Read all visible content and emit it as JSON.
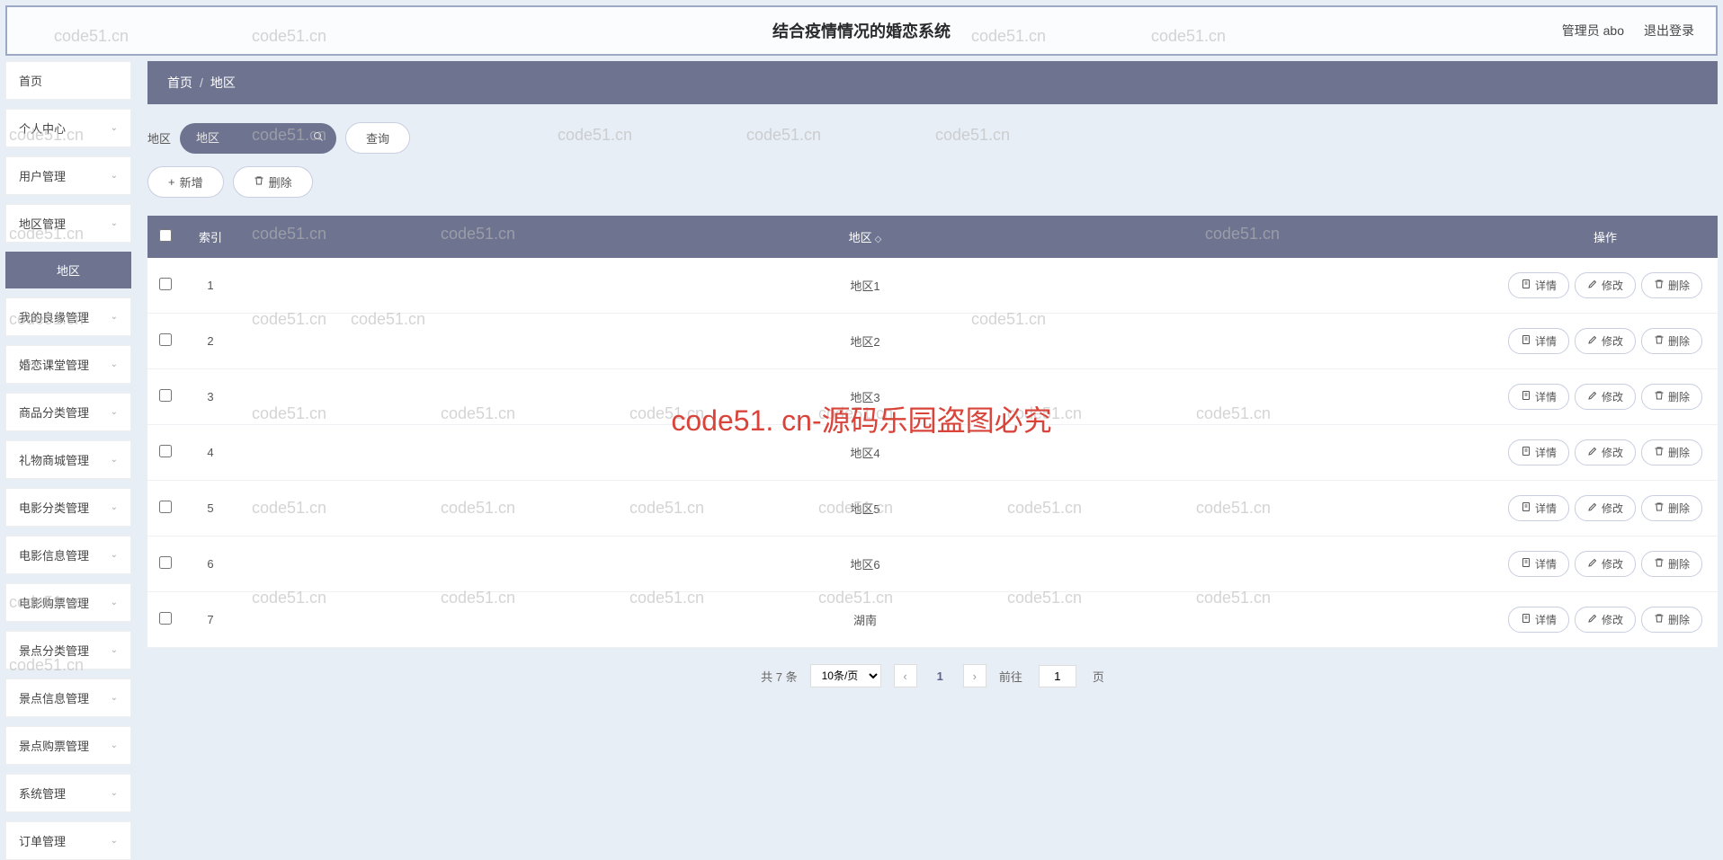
{
  "header": {
    "title": "结合疫情情况的婚恋系统",
    "admin_label": "管理员 abo",
    "logout_label": "退出登录"
  },
  "sidebar": {
    "items": [
      {
        "label": "首页",
        "expandable": false
      },
      {
        "label": "个人中心",
        "expandable": true
      },
      {
        "label": "用户管理",
        "expandable": true
      },
      {
        "label": "地区管理",
        "expandable": true
      },
      {
        "label": "地区",
        "expandable": false,
        "active": true
      },
      {
        "label": "我的良缘管理",
        "expandable": true
      },
      {
        "label": "婚恋课堂管理",
        "expandable": true
      },
      {
        "label": "商品分类管理",
        "expandable": true
      },
      {
        "label": "礼物商城管理",
        "expandable": true
      },
      {
        "label": "电影分类管理",
        "expandable": true
      },
      {
        "label": "电影信息管理",
        "expandable": true
      },
      {
        "label": "电影购票管理",
        "expandable": true
      },
      {
        "label": "景点分类管理",
        "expandable": true
      },
      {
        "label": "景点信息管理",
        "expandable": true
      },
      {
        "label": "景点购票管理",
        "expandable": true
      },
      {
        "label": "系统管理",
        "expandable": true
      },
      {
        "label": "订单管理",
        "expandable": true
      }
    ]
  },
  "breadcrumb": {
    "home": "首页",
    "current": "地区"
  },
  "filter": {
    "label": "地区",
    "search_placeholder": "地区",
    "query_button": "查询"
  },
  "toolbar": {
    "add_label": "新增",
    "delete_label": "删除"
  },
  "table": {
    "headers": {
      "index": "索引",
      "region": "地区",
      "actions": "操作"
    },
    "action_labels": {
      "detail": "详情",
      "edit": "修改",
      "delete": "删除"
    },
    "rows": [
      {
        "idx": "1",
        "region": "地区1"
      },
      {
        "idx": "2",
        "region": "地区2"
      },
      {
        "idx": "3",
        "region": "地区3"
      },
      {
        "idx": "4",
        "region": "地区4"
      },
      {
        "idx": "5",
        "region": "地区5"
      },
      {
        "idx": "6",
        "region": "地区6"
      },
      {
        "idx": "7",
        "region": "湖南"
      }
    ]
  },
  "pagination": {
    "total_label": "共 7 条",
    "page_size": "10条/页",
    "current_page": "1",
    "goto_prefix": "前往",
    "goto_suffix": "页",
    "goto_value": "1"
  },
  "watermark": {
    "main": "code51. cn-源码乐园盗图必究",
    "small": "code51.cn"
  }
}
